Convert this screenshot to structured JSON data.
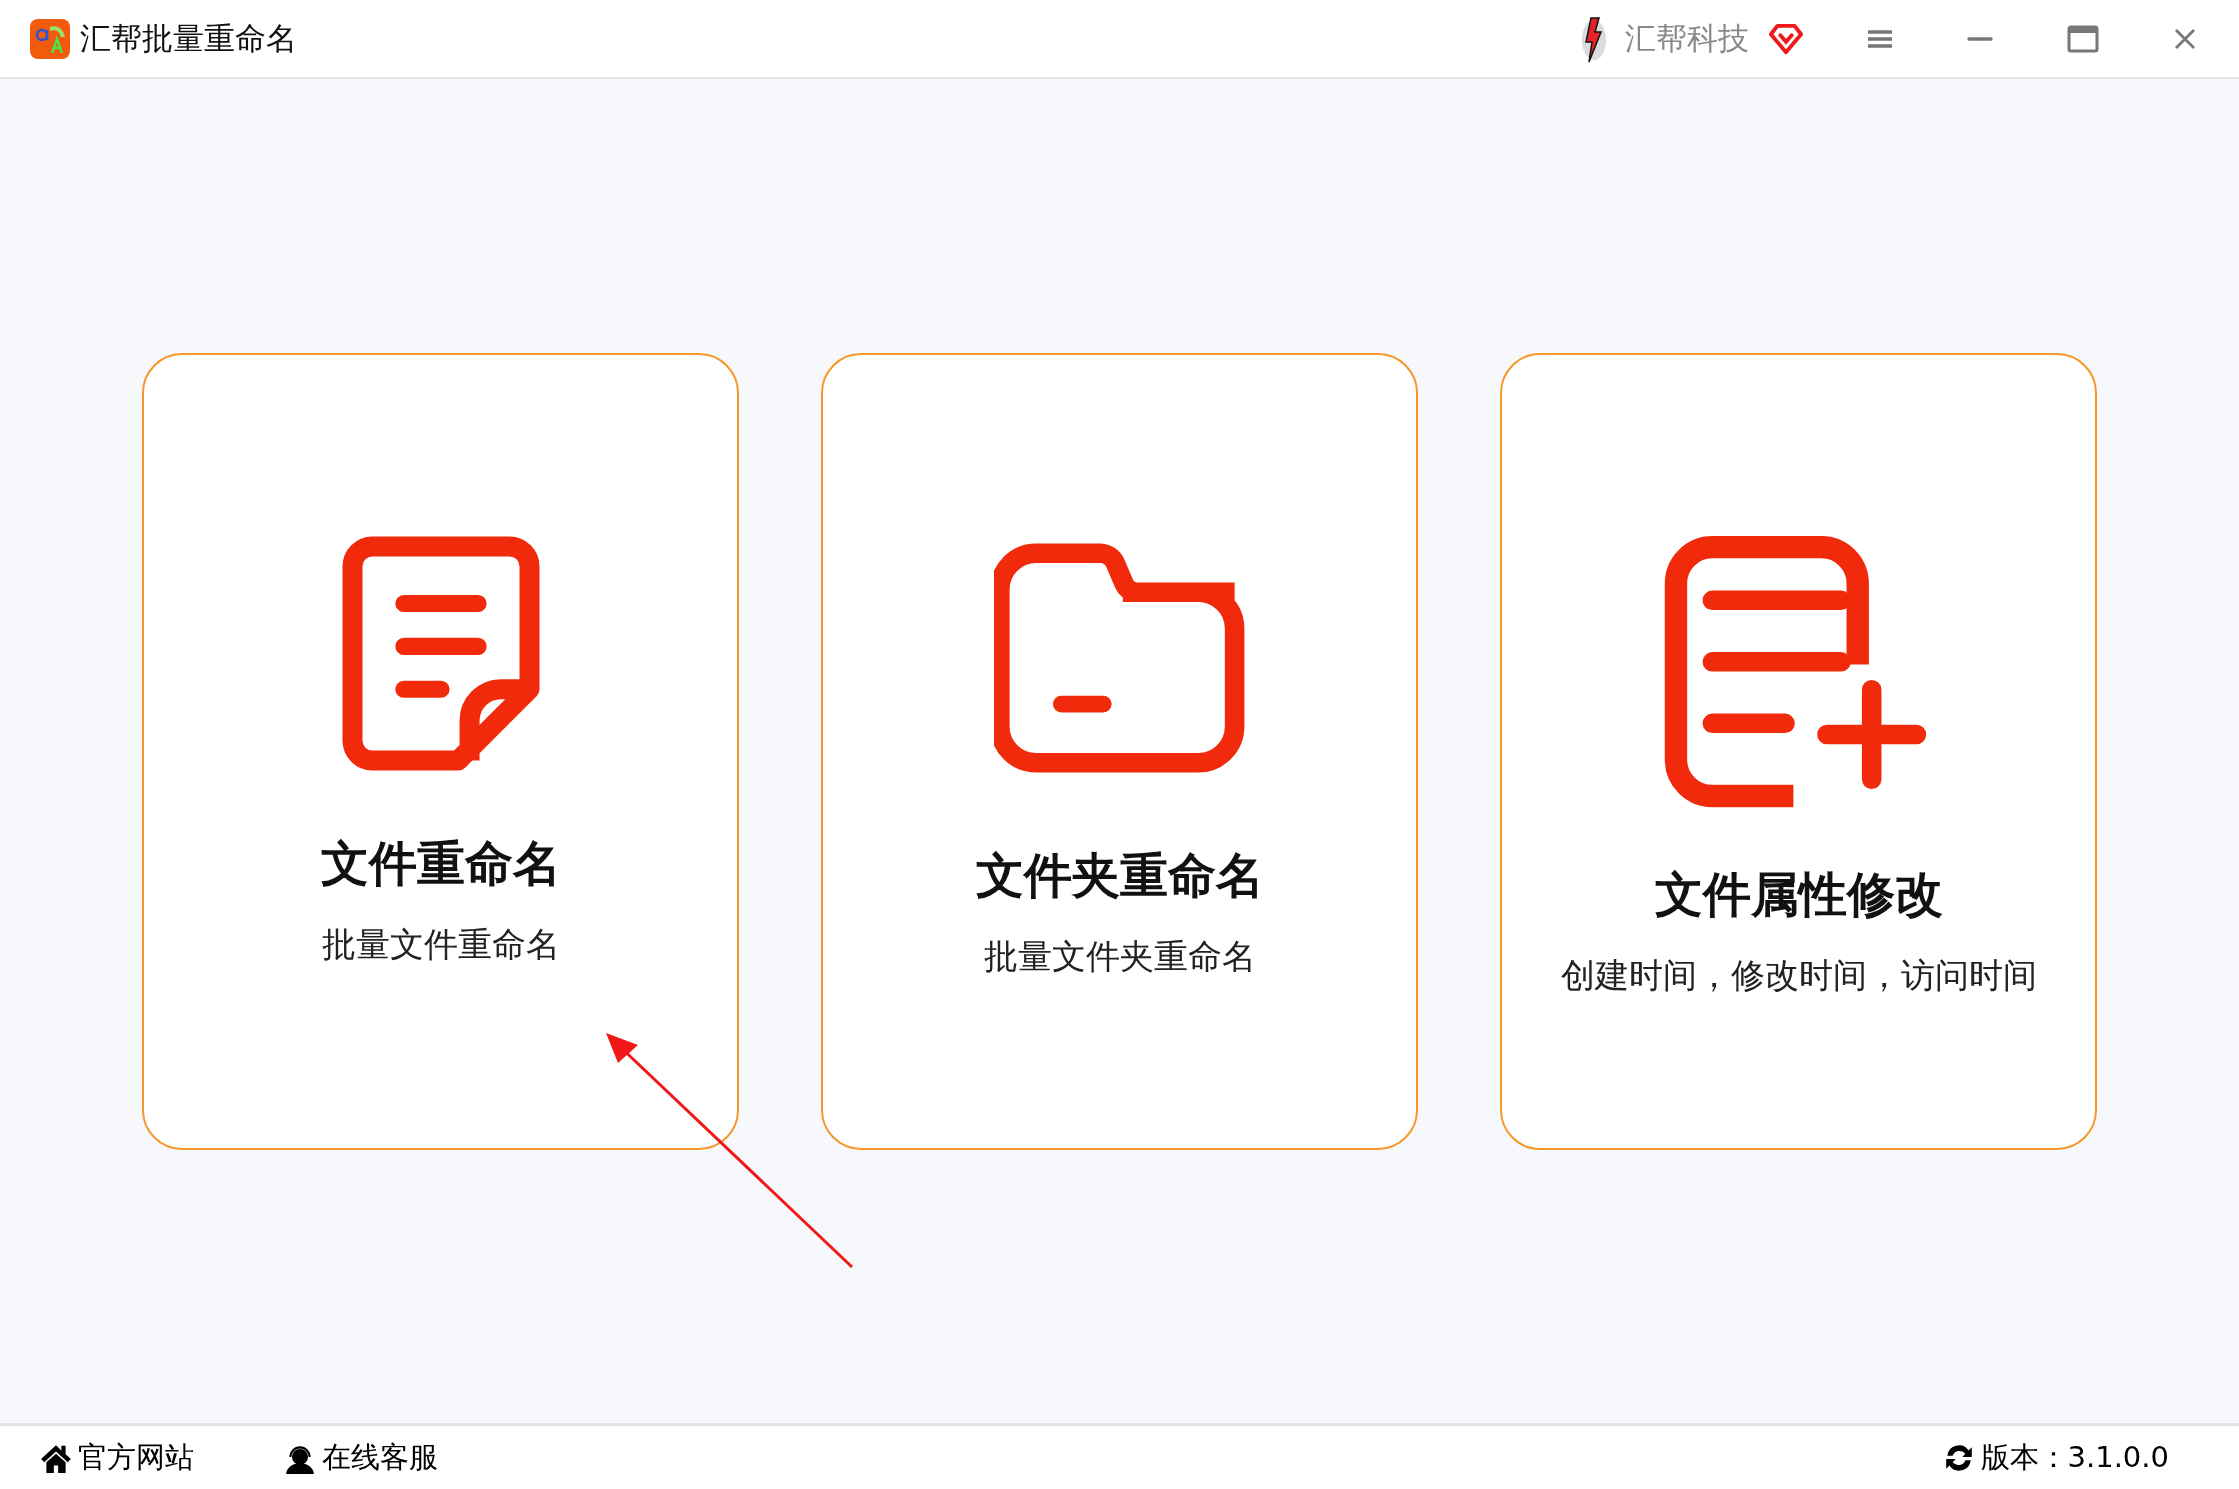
{
  "window": {
    "title": "汇帮批量重命名",
    "brand": "汇帮科技"
  },
  "cards": [
    {
      "kind": "file",
      "title": "文件重命名",
      "subtitle": "批量文件重命名"
    },
    {
      "kind": "folder",
      "title": "文件夹重命名",
      "subtitle": "批量文件夹重命名"
    },
    {
      "kind": "attributes",
      "title": "文件属性修改",
      "subtitle": "创建时间，修改时间，访问时间"
    }
  ],
  "footer": {
    "links": [
      {
        "kind": "home",
        "label": "官方网站"
      },
      {
        "kind": "support",
        "label": "在线客服"
      }
    ],
    "version": "版本：3.1.0.0"
  }
}
